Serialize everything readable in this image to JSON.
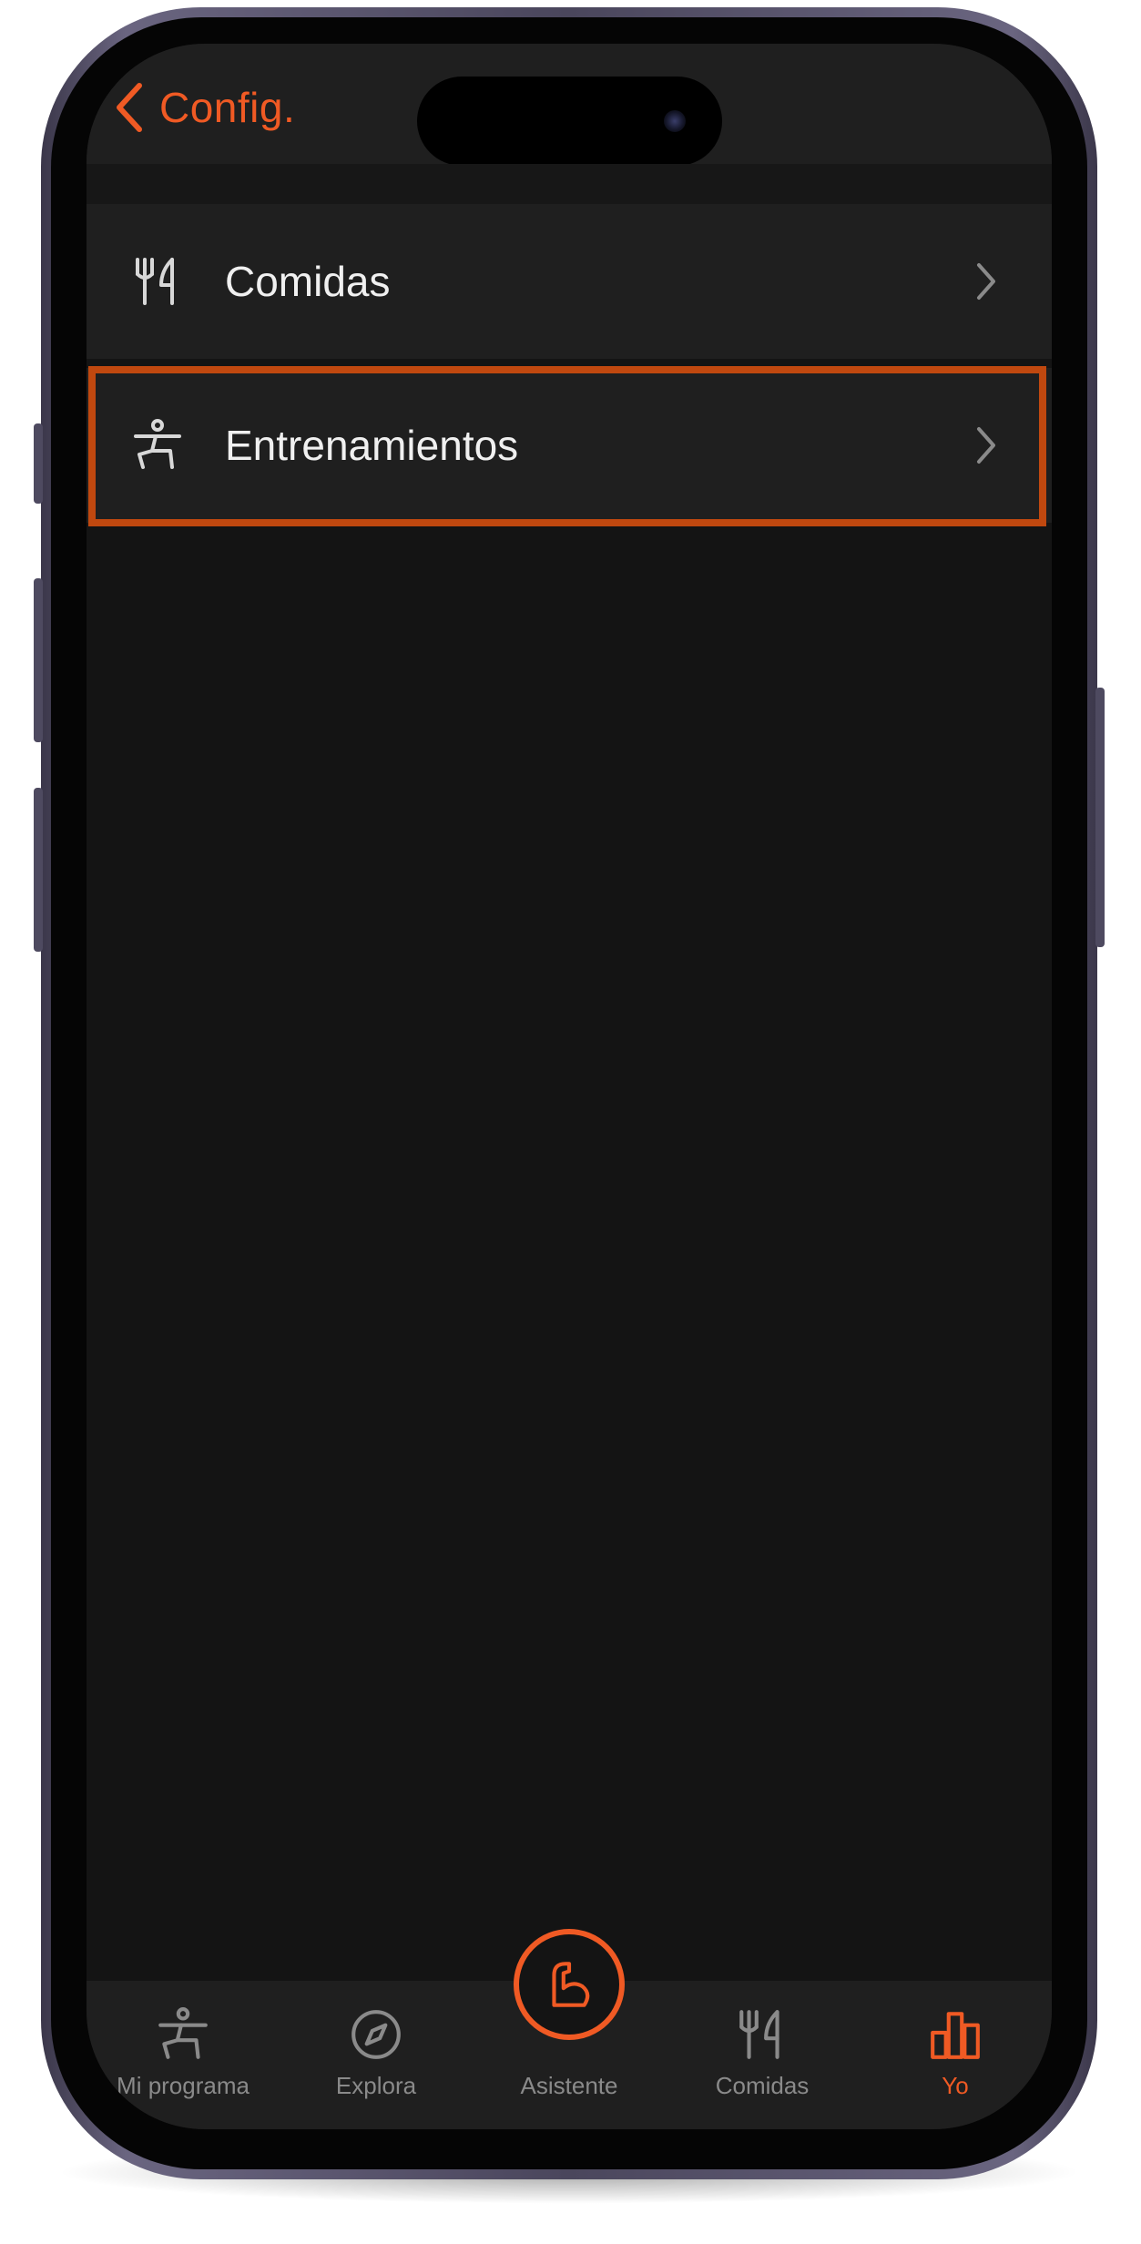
{
  "nav": {
    "back_label": "Config.",
    "accent_color": "#f05a24"
  },
  "list": {
    "items": [
      {
        "label": "Comidas",
        "icon": "fork-knife-icon"
      },
      {
        "label": "Entrenamientos",
        "icon": "exercise-figure-icon"
      }
    ],
    "highlighted_item": "Entrenamientos",
    "highlight_color": "#c0480f"
  },
  "tab_bar": {
    "tabs": [
      {
        "label": "Mi programa",
        "icon": "exercise-figure-icon"
      },
      {
        "label": "Explora",
        "icon": "compass-icon"
      },
      {
        "label": "Asistente",
        "icon": "flexed-arm-icon"
      },
      {
        "label": "Comidas",
        "icon": "fork-knife-icon"
      },
      {
        "label": "Yo",
        "icon": "bar-chart-icon",
        "active": true
      }
    ]
  }
}
